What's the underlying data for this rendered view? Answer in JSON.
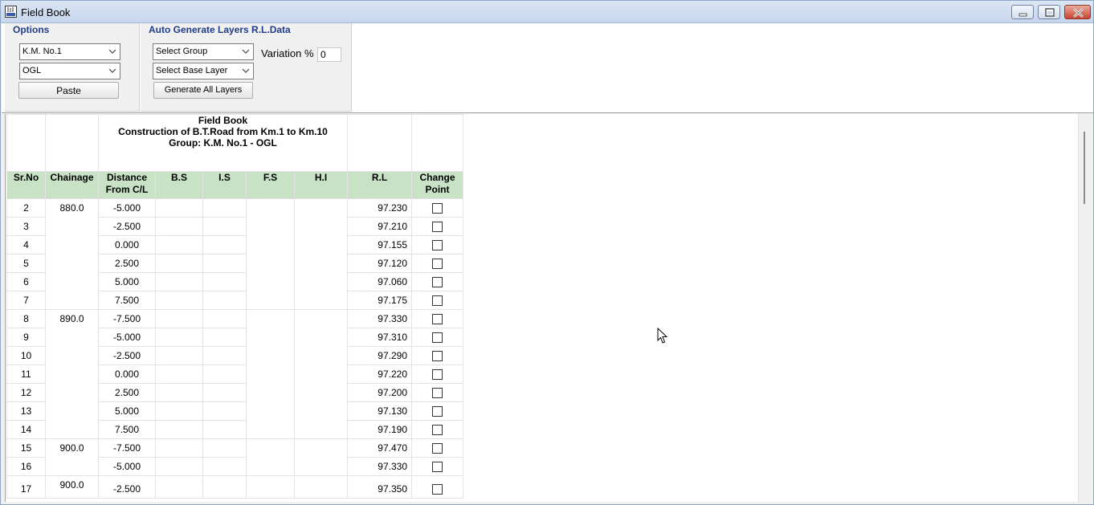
{
  "window": {
    "title": "Field Book"
  },
  "options": {
    "title": "Options",
    "km_select": "K.M. No.1",
    "layer_select": "OGL",
    "paste_label": "Paste"
  },
  "auto_generate": {
    "title": "Auto Generate Layers R.L.Data",
    "group_select": "Select Group",
    "base_layer_select": "Select Base Layer",
    "generate_label": "Generate All Layers",
    "variation_label": "Variation %",
    "variation_value": "0"
  },
  "report": {
    "line1": "Field Book",
    "line2": "Construction of B.T.Road from Km.1 to Km.10",
    "line3": "Group: K.M. No.1 - OGL"
  },
  "columns": {
    "srno": "Sr.No",
    "chainage": "Chainage",
    "distance1": "Distance",
    "distance2": "From C/L",
    "bs": "B.S",
    "is": "I.S",
    "fs": "F.S",
    "hi": "H.I",
    "rl": "R.L",
    "change1": "Change",
    "change2": "Point"
  },
  "rows": [
    {
      "sr": "2",
      "chainage": "880.0",
      "dist": "-5.000",
      "rl": "97.230"
    },
    {
      "sr": "3",
      "chainage": "",
      "dist": "-2.500",
      "rl": "97.210"
    },
    {
      "sr": "4",
      "chainage": "",
      "dist": "0.000",
      "rl": "97.155"
    },
    {
      "sr": "5",
      "chainage": "",
      "dist": "2.500",
      "rl": "97.120"
    },
    {
      "sr": "6",
      "chainage": "",
      "dist": "5.000",
      "rl": "97.060"
    },
    {
      "sr": "7",
      "chainage": "",
      "dist": "7.500",
      "rl": "97.175"
    },
    {
      "sr": "8",
      "chainage": "890.0",
      "dist": "-7.500",
      "rl": "97.330"
    },
    {
      "sr": "9",
      "chainage": "",
      "dist": "-5.000",
      "rl": "97.310"
    },
    {
      "sr": "10",
      "chainage": "",
      "dist": "-2.500",
      "rl": "97.290"
    },
    {
      "sr": "11",
      "chainage": "",
      "dist": "0.000",
      "rl": "97.220"
    },
    {
      "sr": "12",
      "chainage": "",
      "dist": "2.500",
      "rl": "97.200"
    },
    {
      "sr": "13",
      "chainage": "",
      "dist": "5.000",
      "rl": "97.130"
    },
    {
      "sr": "14",
      "chainage": "",
      "dist": "7.500",
      "rl": "97.190"
    },
    {
      "sr": "15",
      "chainage": "900.0",
      "dist": "-7.500",
      "rl": "97.470"
    },
    {
      "sr": "16",
      "chainage": "",
      "dist": "-5.000",
      "rl": "97.330"
    },
    {
      "sr": "17",
      "chainage": "900.0",
      "dist": "-2.500",
      "rl": "97.350"
    }
  ]
}
